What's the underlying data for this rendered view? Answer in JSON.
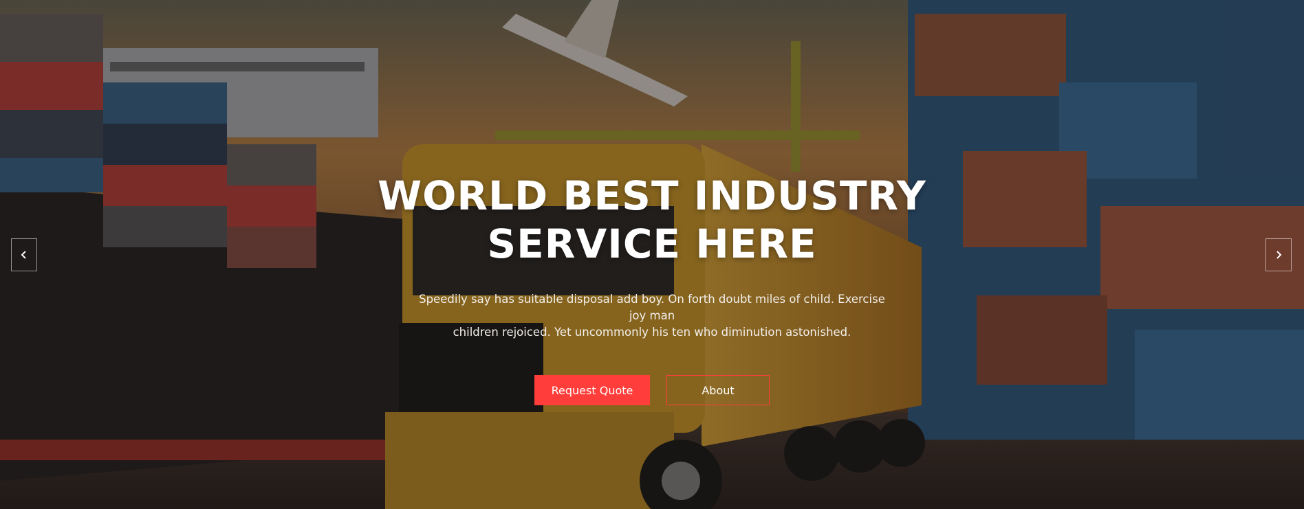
{
  "hero": {
    "headline_line1": "WORLD BEST INDUSTRY",
    "headline_line2": "SERVICE HERE",
    "description_line1": "Speedily say has suitable disposal add boy. On forth doubt miles of child. Exercise joy man",
    "description_line2": "children rejoiced. Yet uncommonly his ten who diminution astonished.",
    "primary_button": "Request Quote",
    "secondary_button": "About"
  },
  "slider": {
    "prev_icon": "chevron-left-icon",
    "next_icon": "chevron-right-icon"
  },
  "colors": {
    "accent": "#ff3d3a",
    "text": "#ffffff"
  }
}
